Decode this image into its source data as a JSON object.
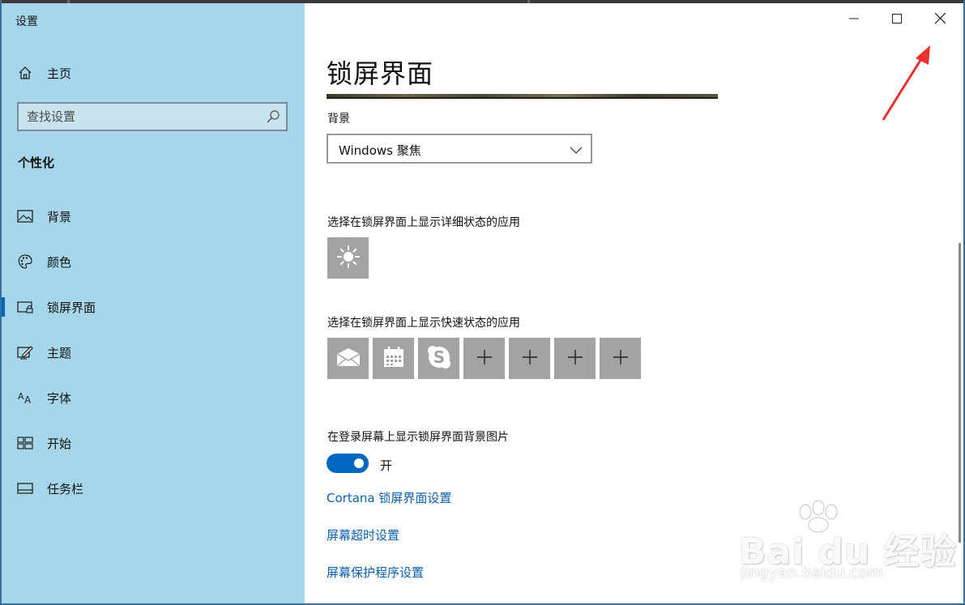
{
  "window": {
    "title": "设置",
    "controls": {
      "minimize": "minimize-icon",
      "maximize": "maximize-icon",
      "close": "close-icon"
    }
  },
  "sidebar": {
    "home_label": "主页",
    "search_placeholder": "查找设置",
    "section_title": "个性化",
    "items": [
      {
        "label": "背景",
        "icon": "picture-icon"
      },
      {
        "label": "颜色",
        "icon": "palette-icon"
      },
      {
        "label": "锁屏界面",
        "icon": "lock-screen-icon",
        "active": true
      },
      {
        "label": "主题",
        "icon": "theme-icon"
      },
      {
        "label": "字体",
        "icon": "font-icon"
      },
      {
        "label": "开始",
        "icon": "start-icon"
      },
      {
        "label": "任务栏",
        "icon": "taskbar-icon"
      }
    ]
  },
  "main": {
    "title": "锁屏界面",
    "background_label": "背景",
    "background_value": "Windows 聚焦",
    "detailed_status_label": "选择在锁屏界面上显示详细状态的应用",
    "detailed_status_tiles": [
      "weather-icon"
    ],
    "quick_status_label": "选择在锁屏界面上显示快速状态的应用",
    "quick_status_tiles": [
      "mail-icon",
      "calendar-icon",
      "skype-icon",
      "plus-icon",
      "plus-icon",
      "plus-icon",
      "plus-icon"
    ],
    "signin_bg_label": "在登录屏幕上显示锁屏界面背景图片",
    "signin_bg_toggle": {
      "on": true,
      "state_label": "开"
    },
    "links": {
      "cortana": "Cortana 锁屏界面设置",
      "timeout": "屏幕超时设置",
      "screensaver": "屏幕保护程序设置"
    }
  },
  "watermark": {
    "brand": "Bai du 经验",
    "domain": "jingyan.baidu.com"
  },
  "colors": {
    "sidebar_bg": "#a6d6ea",
    "accent": "#0067c0",
    "link": "#0a5fb0",
    "tile_bg": "#a3a3a3",
    "arrow": "#e8322f"
  }
}
